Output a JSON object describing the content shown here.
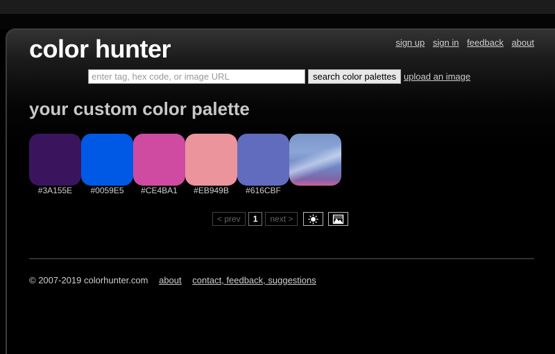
{
  "site": {
    "logo": "color hunter"
  },
  "nav": {
    "items": [
      "sign up",
      "sign in",
      "feedback",
      "about"
    ]
  },
  "search": {
    "placeholder": "enter tag, hex code, or image URL",
    "button_label": "search color palettes",
    "upload_label": "upload an image"
  },
  "main": {
    "heading": "your custom color palette"
  },
  "palette": {
    "swatches": [
      {
        "code": "#3A155E",
        "color": "#3A155E"
      },
      {
        "code": "#0059E5",
        "color": "#0059E5"
      },
      {
        "code": "#CE4BA1",
        "color": "#CE4BA1"
      },
      {
        "code": "#EB949B",
        "color": "#EB949B"
      },
      {
        "code": "#616CBF",
        "color": "#616CBF"
      }
    ]
  },
  "pager": {
    "prev": "< prev",
    "current": "1",
    "next": "next >",
    "icons": [
      "brightness-icon",
      "image-thumbnail-icon"
    ]
  },
  "footer": {
    "copyright": "© 2007-2019 colorhunter.com",
    "about": "about",
    "contact": "contact, feedback, suggestions"
  }
}
